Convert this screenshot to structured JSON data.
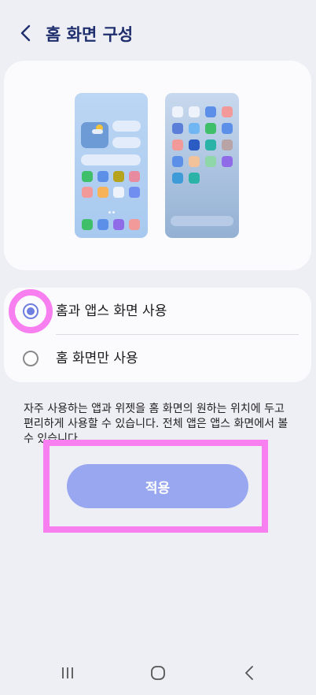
{
  "header": {
    "back_icon": "chevron-left-icon",
    "title": "홈 화면 구성"
  },
  "colors": {
    "background": "#eeeef5",
    "card": "#fbfbfd",
    "title": "#1f2f6e",
    "accent": "#6f7fe0",
    "apply_button": "#98a7f0",
    "highlight": "#f77ff0"
  },
  "preview": {
    "home_icon_colors": [
      "#3fbf6a",
      "#5b8fe8",
      "#b6a31e",
      "#e88aa0",
      "#f29a9a",
      "#f7b35a",
      "#eef3fb",
      "#6f8ef0"
    ],
    "home_dock_colors": [
      "#3fbf6a",
      "#5b8fe8",
      "#8f6be8",
      "#f29a9a"
    ],
    "apps_icon_colors": [
      "#eef3fb",
      "#eef3fb",
      "#5b8fe8",
      "#f29a9a",
      "#5b7fd8",
      "#6fb6f2",
      "#3fbf6a",
      "#5b8fe8",
      "#f29a9a",
      "#2a5cc4",
      "#2ab3a6",
      "#b8a3a6",
      "#5b8fe8",
      "#f2c29a",
      "#8fd6a8",
      "#8f6be8",
      "#3f9ad8",
      "#2ab3a6"
    ]
  },
  "options": [
    {
      "label": "홈과 앱스 화면 사용",
      "selected": true
    },
    {
      "label": "홈 화면만 사용",
      "selected": false
    }
  ],
  "description": "자주 사용하는 앱과 위젯을 홈 화면의 원하는 위치에 두고 편리하게 사용할 수 있습니다. 전체 앱은 앱스 화면에서 볼 수 있습니다.",
  "apply_label": "적용",
  "navbar": {
    "recent_icon": "recent-apps-icon",
    "home_icon": "home-icon",
    "back_icon": "back-icon"
  }
}
